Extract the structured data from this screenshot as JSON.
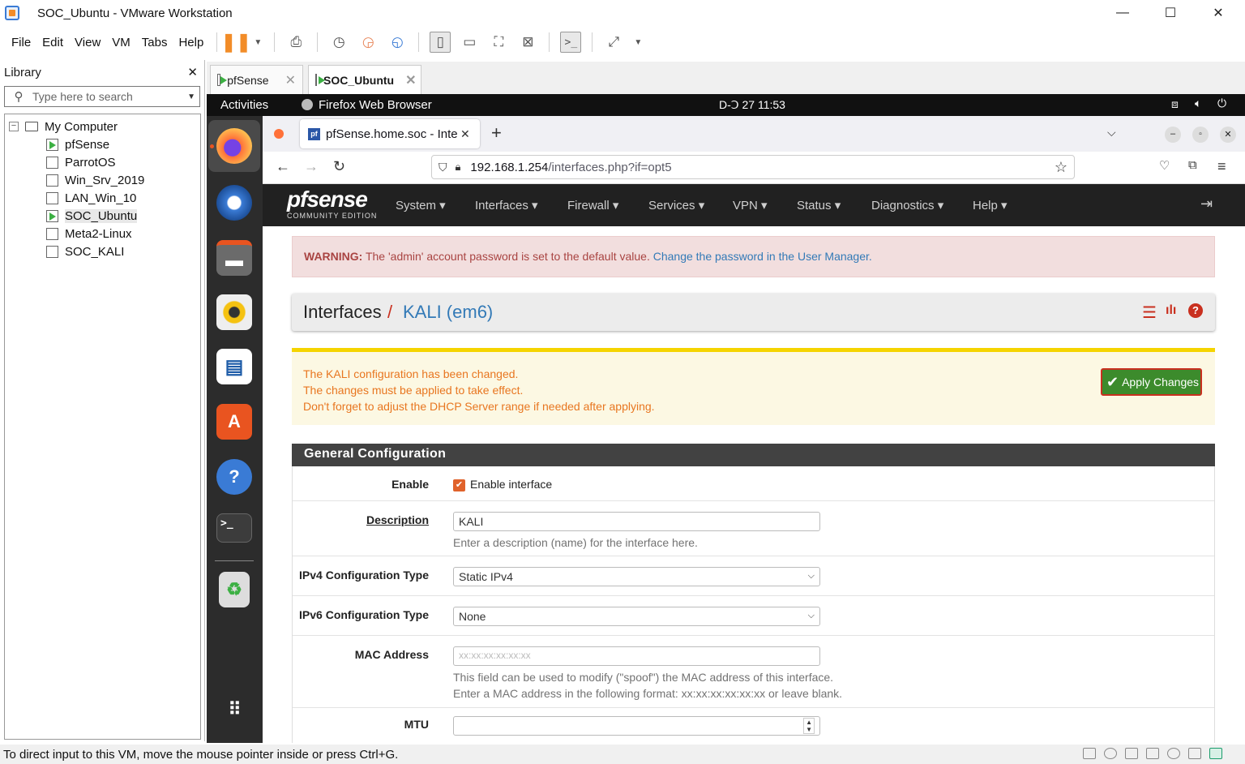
{
  "window": {
    "title": "SOC_Ubuntu - VMware Workstation",
    "minimize": "—",
    "maximize": "☐",
    "close": "✕"
  },
  "menubar": {
    "items": [
      "File",
      "Edit",
      "View",
      "VM",
      "Tabs",
      "Help"
    ]
  },
  "library": {
    "title": "Library",
    "close": "✕",
    "search_placeholder": "Type here to search",
    "root": "My Computer",
    "vms": [
      {
        "name": "pfSense",
        "running": true
      },
      {
        "name": "ParrotOS",
        "running": false
      },
      {
        "name": "Win_Srv_2019",
        "running": false
      },
      {
        "name": "LAN_Win_10",
        "running": false
      },
      {
        "name": "SOC_Ubuntu",
        "running": true,
        "selected": true
      },
      {
        "name": "Meta2-Linux",
        "running": false
      },
      {
        "name": "SOC_KALI",
        "running": false
      }
    ]
  },
  "vm_tabs": [
    {
      "label": "pfSense",
      "active": false
    },
    {
      "label": "SOC_Ubuntu",
      "active": true
    }
  ],
  "gnome": {
    "activities": "Activities",
    "app": "Firefox Web Browser",
    "clock": "D-Ↄ 27  11:53"
  },
  "firefox": {
    "tab_title": "pfSense.home.soc - Interf",
    "new_tab": "+",
    "url_host": "192.168.1.254",
    "url_path": "/interfaces.php?if=opt5"
  },
  "pfsense": {
    "logo_main": "pfsense",
    "logo_sub": "COMMUNITY EDITION",
    "nav": [
      "System",
      "Interfaces",
      "Firewall",
      "Services",
      "VPN",
      "Status",
      "Diagnostics",
      "Help"
    ],
    "warning": {
      "label": "WARNING:",
      "text": " The 'admin' account password is set to the default value. ",
      "link": "Change the password in the User Manager."
    },
    "breadcrumb": {
      "root": "Interfaces",
      "sep": "/",
      "current": "KALI (em6)"
    },
    "notice": {
      "lines": [
        "The KALI configuration has been changed.",
        "The changes must be applied to take effect.",
        "Don't forget to adjust the DHCP Server range if needed after applying."
      ],
      "apply_label": "Apply Changes"
    },
    "section_title": "General Configuration",
    "enable": {
      "label": "Enable",
      "checkbox_label": "Enable interface",
      "checked": true
    },
    "description": {
      "label": "Description",
      "value": "KALI",
      "help": "Enter a description (name) for the interface here."
    },
    "ipv4": {
      "label": "IPv4 Configuration Type",
      "value": "Static IPv4"
    },
    "ipv6": {
      "label": "IPv6 Configuration Type",
      "value": "None"
    },
    "mac": {
      "label": "MAC Address",
      "placeholder": "xx:xx:xx:xx:xx:xx",
      "help1": "This field can be used to modify (\"spoof\") the MAC address of this interface.",
      "help2": "Enter a MAC address in the following format: xx:xx:xx:xx:xx:xx or leave blank."
    },
    "mtu": {
      "label": "MTU",
      "value": ""
    }
  },
  "status": {
    "text": "To direct input to this VM, move the mouse pointer inside or press Ctrl+G."
  },
  "colors": {
    "pf_red": "#c9301f",
    "pf_blue": "#337ab7",
    "apply_green": "#3c8b2c",
    "notice_orange": "#e87620"
  }
}
